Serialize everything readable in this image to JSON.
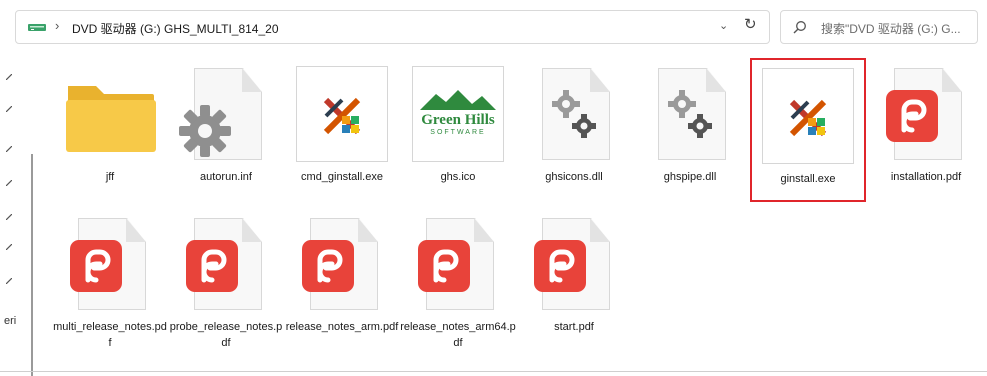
{
  "address_bar": {
    "path": "DVD 驱动器 (G:) GHS_MULTI_814_20",
    "separator": "›",
    "chevron": "⌄",
    "refresh": "↻"
  },
  "search": {
    "placeholder": "搜索\"DVD 驱动器 (G:) G..."
  },
  "left_pane": {
    "partial_label": "eri"
  },
  "files": [
    {
      "name": "jff",
      "type": "folder-icon"
    },
    {
      "name": "autorun.inf",
      "type": "settings-file-icon"
    },
    {
      "name": "cmd_ginstall.exe",
      "type": "installer-exe-icon"
    },
    {
      "name": "ghs.ico",
      "type": "green-hills-logo-icon"
    },
    {
      "name": "ghsicons.dll",
      "type": "dll-gears-icon"
    },
    {
      "name": "ghspipe.dll",
      "type": "dll-gears-icon"
    },
    {
      "name": "ginstall.exe",
      "type": "installer-exe-icon",
      "selected": true
    },
    {
      "name": "installation.pdf",
      "type": "pdf-icon"
    },
    {
      "name": "multi_release_notes.pdf",
      "type": "pdf-icon"
    },
    {
      "name": "probe_release_notes.pdf",
      "type": "pdf-icon"
    },
    {
      "name": "release_notes_arm.pdf",
      "type": "pdf-icon"
    },
    {
      "name": "release_notes_arm64.pdf",
      "type": "pdf-icon"
    },
    {
      "name": "start.pdf",
      "type": "pdf-icon"
    }
  ],
  "logo_text": {
    "brand": "Green Hills",
    "sub": "SOFTWARE"
  },
  "colors": {
    "selection": "#e0252b",
    "folder": "#f5c542",
    "pdf_red": "#e8433a",
    "logo_green": "#2f8a3e"
  }
}
